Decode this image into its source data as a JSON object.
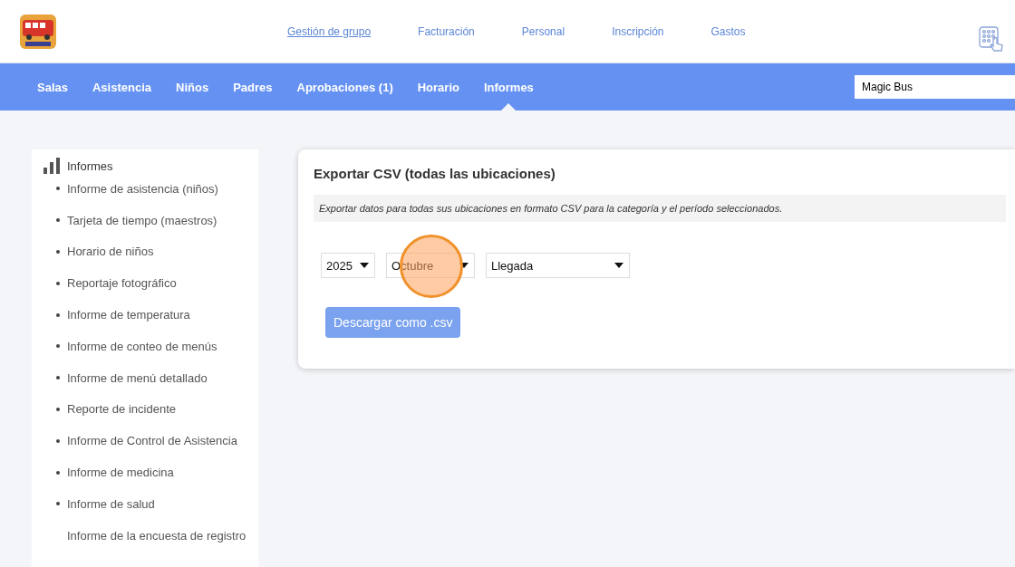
{
  "top_links": [
    {
      "label": "Gestión de grupo",
      "selected": true
    },
    {
      "label": "Facturación",
      "selected": false
    },
    {
      "label": "Personal",
      "selected": false
    },
    {
      "label": "Inscripción",
      "selected": false
    },
    {
      "label": "Gastos",
      "selected": false
    }
  ],
  "nav": [
    {
      "label": "Salas",
      "selected": false
    },
    {
      "label": "Asistencia",
      "selected": false
    },
    {
      "label": "Niños",
      "selected": false
    },
    {
      "label": "Padres",
      "selected": false
    },
    {
      "label": "Aprobaciones (1)",
      "selected": false
    },
    {
      "label": "Horario",
      "selected": false
    },
    {
      "label": "Informes",
      "selected": true
    }
  ],
  "location_field": {
    "value": "Magic Bus"
  },
  "sidebar": {
    "title": "Informes",
    "items": [
      {
        "label": "Informe de asistencia (niños)",
        "bullet": true
      },
      {
        "label": "Tarjeta de tiempo (maestros)",
        "bullet": true
      },
      {
        "label": "Horario de niños",
        "bullet": true
      },
      {
        "label": "Reportaje fotográfico",
        "bullet": true
      },
      {
        "label": "Informe de temperatura",
        "bullet": true
      },
      {
        "label": "Informe de conteo de menús",
        "bullet": true
      },
      {
        "label": "Informe de menú detallado",
        "bullet": true
      },
      {
        "label": "Reporte de incidente",
        "bullet": true
      },
      {
        "label": "Informe de Control de Asistencia",
        "bullet": true
      },
      {
        "label": "Informe de medicina",
        "bullet": true
      },
      {
        "label": "Informe de salud",
        "bullet": true
      },
      {
        "label": "Informe de la encuesta de registro",
        "bullet": false
      }
    ]
  },
  "card": {
    "title": "Exportar CSV (todas las ubicaciones)",
    "description": "Exportar datos para todas sus ubicaciones en formato CSV para la categoría y el período seleccionados.",
    "selects": [
      {
        "value": "2025",
        "click_marker": false
      },
      {
        "value": "Octubre",
        "click_marker": true
      },
      {
        "value": "Llegada",
        "click_marker": false
      }
    ],
    "button": "Descargar como .csv"
  }
}
